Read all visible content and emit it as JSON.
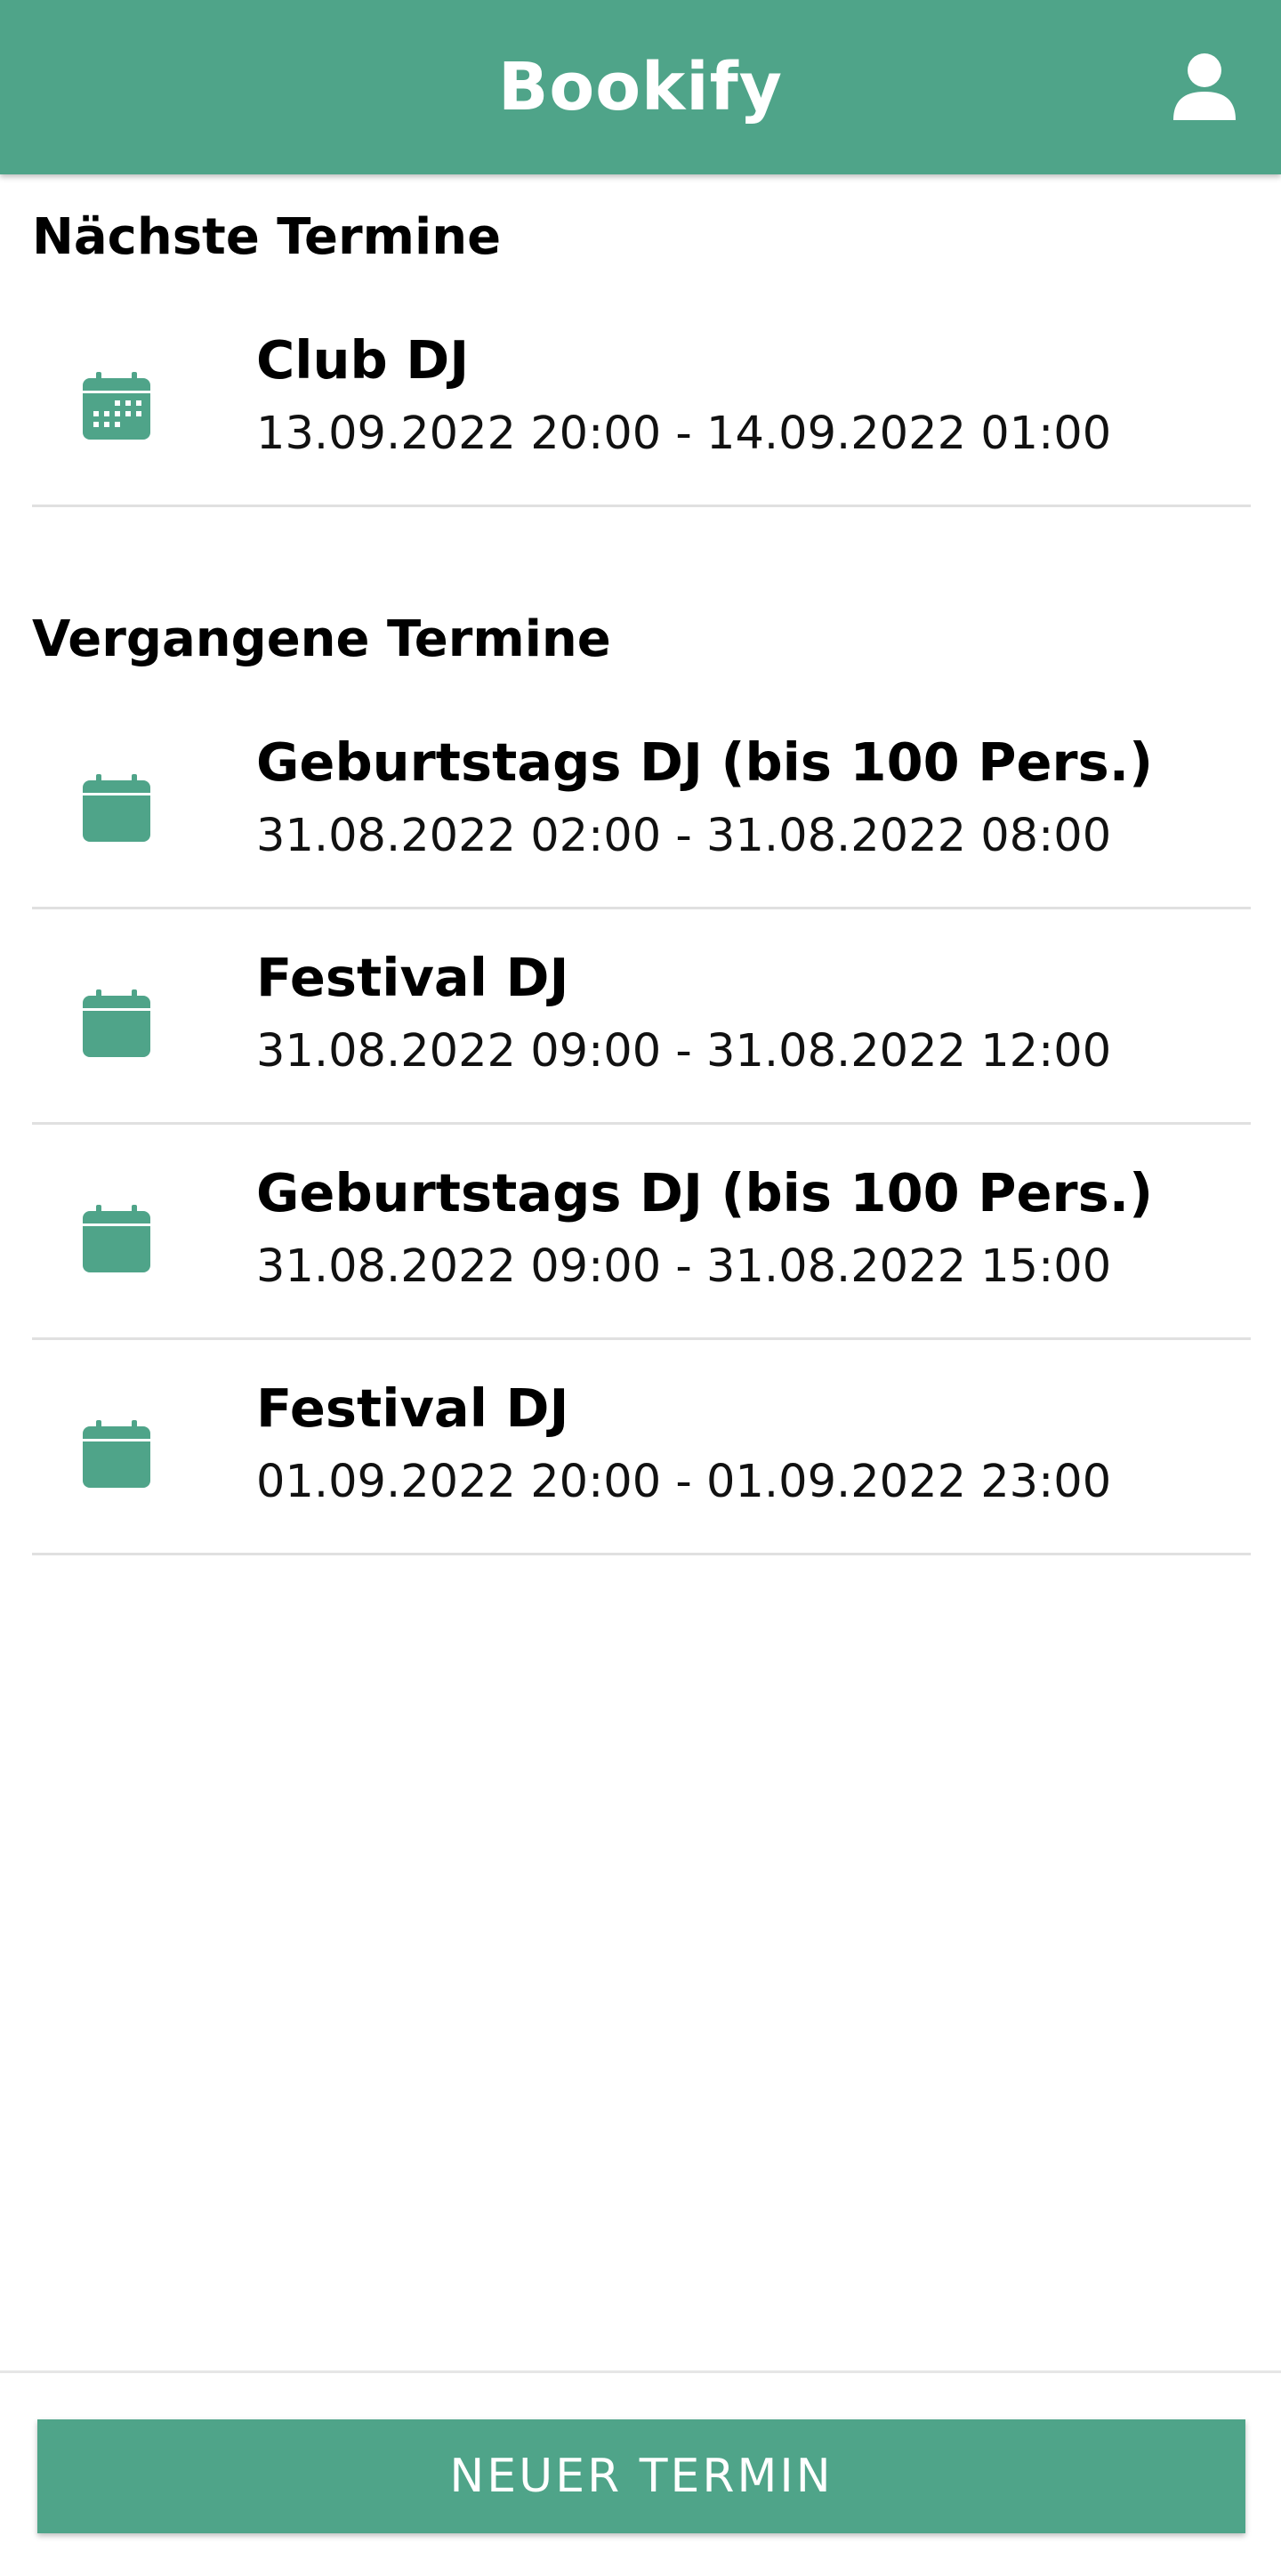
{
  "app": {
    "title": "Bookify"
  },
  "colors": {
    "primary": "#4fa489"
  },
  "sections": {
    "upcoming": {
      "title": "Nächste Termine",
      "items": [
        {
          "title": "Club DJ",
          "time": "13.09.2022 20:00 - 14.09.2022 01:00",
          "icon": "calendar-days-icon"
        }
      ]
    },
    "past": {
      "title": "Vergangene Termine",
      "items": [
        {
          "title": "Geburtstags DJ (bis 100 Pers.)",
          "time": "31.08.2022 02:00 - 31.08.2022 08:00",
          "icon": "calendar-icon"
        },
        {
          "title": "Festival DJ",
          "time": "31.08.2022 09:00 - 31.08.2022 12:00",
          "icon": "calendar-icon"
        },
        {
          "title": "Geburtstags DJ (bis 100 Pers.)",
          "time": "31.08.2022 09:00 - 31.08.2022 15:00",
          "icon": "calendar-icon"
        },
        {
          "title": "Festival DJ",
          "time": "01.09.2022 20:00 - 01.09.2022 23:00",
          "icon": "calendar-icon"
        }
      ]
    }
  },
  "actions": {
    "new_appointment_label": "NEUER TERMIN"
  }
}
